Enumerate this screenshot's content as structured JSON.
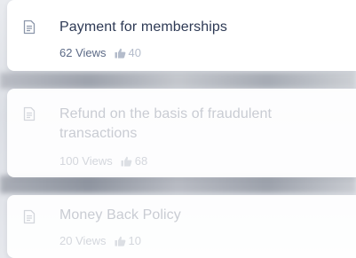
{
  "articles": [
    {
      "title": "Payment for memberships",
      "views": "62 Views",
      "likes": "40"
    },
    {
      "title": "Refund on the basis of fraudulent transactions",
      "views": "100 Views",
      "likes": "68"
    },
    {
      "title": "Money Back Policy",
      "views": "20 Views",
      "likes": "10"
    }
  ],
  "icons": {
    "article": "document-icon",
    "likes": "thumbs-up-icon"
  },
  "colors": {
    "title_active": "#2e3a55",
    "meta_active": "#5c6a86",
    "faded_text": "#c9ccd3"
  }
}
